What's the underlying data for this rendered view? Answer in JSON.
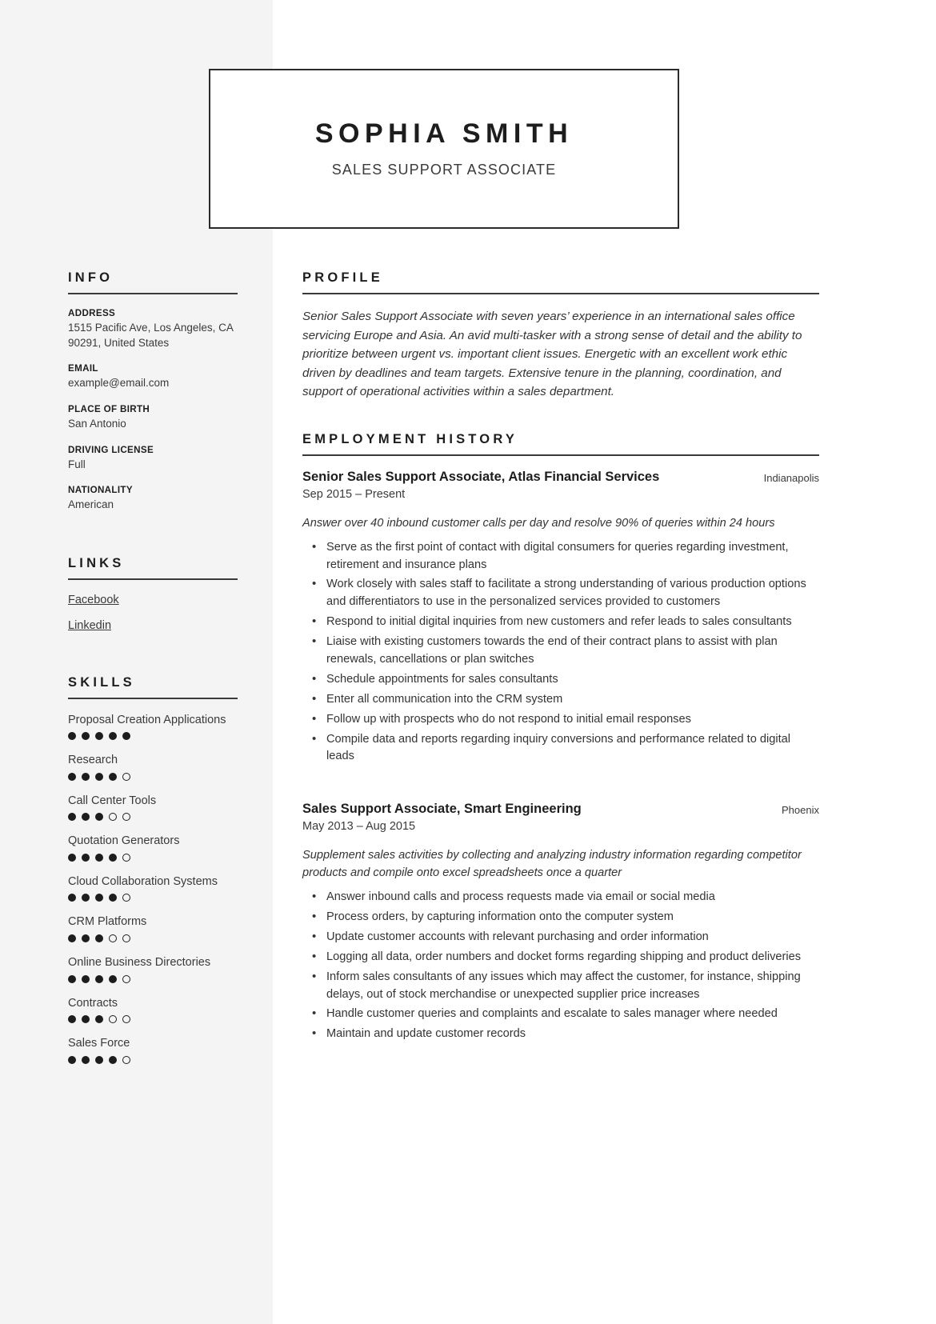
{
  "header": {
    "name": "SOPHIA SMITH",
    "job_title": "SALES SUPPORT ASSOCIATE"
  },
  "sidebar": {
    "info": {
      "heading": "INFO",
      "fields": [
        {
          "label": "ADDRESS",
          "value": "1515 Pacific Ave, Los Angeles, CA 90291, United States"
        },
        {
          "label": "EMAIL",
          "value": "example@email.com"
        },
        {
          "label": "PLACE OF BIRTH",
          "value": "San Antonio"
        },
        {
          "label": "DRIVING LICENSE",
          "value": "Full"
        },
        {
          "label": "NATIONALITY",
          "value": "American"
        }
      ]
    },
    "links": {
      "heading": "LINKS",
      "items": [
        {
          "label": "Facebook"
        },
        {
          "label": "Linkedin"
        }
      ]
    },
    "skills": {
      "heading": "SKILLS",
      "max_level": 5,
      "items": [
        {
          "name": "Proposal Creation Applications",
          "level": 5
        },
        {
          "name": "Research",
          "level": 4
        },
        {
          "name": "Call Center Tools",
          "level": 3
        },
        {
          "name": "Quotation Generators",
          "level": 4
        },
        {
          "name": "Cloud Collaboration Systems",
          "level": 4
        },
        {
          "name": "CRM Platforms",
          "level": 3
        },
        {
          "name": "Online Business Directories",
          "level": 4
        },
        {
          "name": "Contracts",
          "level": 3
        },
        {
          "name": "Sales Force",
          "level": 4
        }
      ]
    }
  },
  "main": {
    "profile": {
      "heading": "PROFILE",
      "text": "Senior Sales Support Associate with seven years’ experience in an international sales office servicing Europe and Asia. An avid multi-tasker with a strong sense of detail and the ability to prioritize between urgent vs. important client issues. Energetic with an excellent work ethic driven by deadlines and team targets. Extensive tenure in the planning, coordination, and support of operational activities within a sales department."
    },
    "employment": {
      "heading": "EMPLOYMENT HISTORY",
      "jobs": [
        {
          "role": "Senior Sales Support Associate, Atlas Financial Services",
          "location": "Indianapolis",
          "dates": "Sep 2015 – Present",
          "summary": "Answer over 40 inbound customer calls per day and resolve 90% of queries within 24 hours",
          "bullets": [
            "Serve as the first point of contact with digital consumers for queries regarding investment, retirement and insurance plans",
            "Work closely with sales staff to facilitate a strong understanding of various production options and differentiators to use in the personalized services provided to customers",
            "Respond to initial digital inquiries from new customers and refer leads to sales consultants",
            "Liaise with existing customers towards the end of their contract plans to assist with plan renewals, cancellations or plan switches",
            "Schedule appointments for sales consultants",
            "Enter all communication into the CRM system",
            "Follow up with prospects who do not respond to initial email responses",
            "Compile data and reports regarding inquiry conversions and performance related to digital leads"
          ]
        },
        {
          "role": "Sales Support Associate, Smart Engineering",
          "location": "Phoenix",
          "dates": "May 2013 – Aug 2015",
          "summary": "Supplement sales activities by collecting and analyzing industry information regarding competitor products and compile onto excel spreadsheets once a quarter",
          "bullets": [
            "Answer inbound calls and process requests made via email or social media",
            "Process orders, by capturing information onto the computer system",
            "Update customer accounts with relevant purchasing and order information",
            "Logging all data, order numbers and docket forms regarding shipping and product deliveries",
            "Inform sales consultants of any issues which may affect the customer, for instance, shipping delays, out of stock merchandise or unexpected supplier price increases",
            "Handle customer queries and complaints and escalate to sales manager where needed",
            "Maintain and update customer records"
          ]
        }
      ]
    }
  },
  "colors": {
    "sidebar_bg": "#f4f4f4",
    "text_dark": "#1d1d1d",
    "text_body": "#343434",
    "rule": "#3a3a3a"
  }
}
